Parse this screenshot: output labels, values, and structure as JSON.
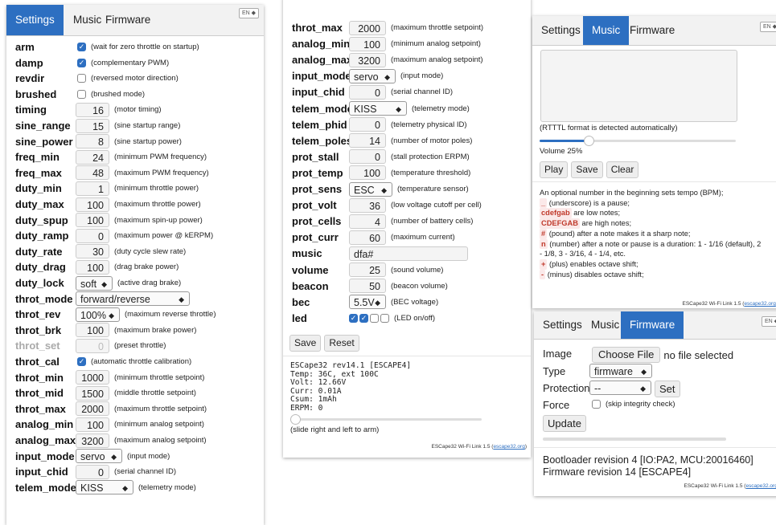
{
  "tabs": [
    "Settings",
    "Music",
    "Firmware"
  ],
  "lang": "EN",
  "left_params": [
    {
      "label": "arm",
      "type": "check",
      "checked": true,
      "desc": "(wait for zero throttle on startup)"
    },
    {
      "label": "damp",
      "type": "check",
      "checked": true,
      "desc": "(complementary PWM)"
    },
    {
      "label": "revdir",
      "type": "check",
      "checked": false,
      "desc": "(reversed motor direction)"
    },
    {
      "label": "brushed",
      "type": "check",
      "checked": false,
      "desc": "(brushed mode)"
    },
    {
      "label": "timing",
      "type": "num",
      "value": "16",
      "desc": "(motor timing)"
    },
    {
      "label": "sine_range",
      "type": "num",
      "value": "15",
      "desc": "(sine startup range)"
    },
    {
      "label": "sine_power",
      "type": "num",
      "value": "8",
      "desc": "(sine startup power)"
    },
    {
      "label": "freq_min",
      "type": "num",
      "value": "24",
      "desc": "(minimum PWM frequency)"
    },
    {
      "label": "freq_max",
      "type": "num",
      "value": "48",
      "desc": "(maximum PWM frequency)"
    },
    {
      "label": "duty_min",
      "type": "num",
      "value": "1",
      "desc": "(minimum throttle power)"
    },
    {
      "label": "duty_max",
      "type": "num",
      "value": "100",
      "desc": "(maximum throttle power)"
    },
    {
      "label": "duty_spup",
      "type": "num",
      "value": "100",
      "desc": "(maximum spin-up power)"
    },
    {
      "label": "duty_ramp",
      "type": "num",
      "value": "0",
      "desc": "(maximum power @ kERPM)"
    },
    {
      "label": "duty_rate",
      "type": "num",
      "value": "30",
      "desc": "(duty cycle slew rate)"
    },
    {
      "label": "duty_drag",
      "type": "num",
      "value": "100",
      "desc": "(drag brake power)"
    },
    {
      "label": "duty_lock",
      "type": "select",
      "value": "soft",
      "w": 46,
      "desc": "(active drag brake)"
    },
    {
      "label": "throt_mode",
      "type": "select",
      "value": "forward/reverse",
      "w": 142,
      "desc": ""
    },
    {
      "label": "throt_rev",
      "type": "select",
      "value": "100%",
      "w": 55,
      "desc": "(maximum reverse throttle)"
    },
    {
      "label": "throt_brk",
      "type": "num",
      "value": "100",
      "desc": "(maximum brake power)"
    },
    {
      "label": "throt_set",
      "type": "num",
      "value": "0",
      "desc": "(preset throttle)",
      "disabled": true
    },
    {
      "label": "throt_cal",
      "type": "check",
      "checked": true,
      "desc": "(automatic throttle calibration)"
    },
    {
      "label": "throt_min",
      "type": "num",
      "value": "1000",
      "desc": "(minimum throttle setpoint)"
    },
    {
      "label": "throt_mid",
      "type": "num",
      "value": "1500",
      "desc": "(middle throttle setpoint)"
    },
    {
      "label": "throt_max",
      "type": "num",
      "value": "2000",
      "desc": "(maximum throttle setpoint)"
    },
    {
      "label": "analog_min",
      "type": "num",
      "value": "100",
      "desc": "(minimum analog setpoint)"
    },
    {
      "label": "analog_max",
      "type": "num",
      "value": "3200",
      "desc": "(maximum analog setpoint)"
    },
    {
      "label": "input_mode",
      "type": "select",
      "value": "servo",
      "w": 58,
      "desc": "(input mode)"
    },
    {
      "label": "input_chid",
      "type": "num",
      "value": "0",
      "desc": "(serial channel ID)"
    },
    {
      "label": "telem_mode",
      "type": "select",
      "value": "KISS",
      "w": 72,
      "desc": "(telemetry mode)"
    }
  ],
  "mid_params": [
    {
      "label": "throt_max",
      "type": "num",
      "value": "2000",
      "desc": "(maximum throttle setpoint)"
    },
    {
      "label": "analog_min",
      "type": "num",
      "value": "100",
      "desc": "(minimum analog setpoint)"
    },
    {
      "label": "analog_max",
      "type": "num",
      "value": "3200",
      "desc": "(maximum analog setpoint)"
    },
    {
      "label": "input_mode",
      "type": "select",
      "value": "servo",
      "w": 58,
      "desc": "(input mode)"
    },
    {
      "label": "input_chid",
      "type": "num",
      "value": "0",
      "desc": "(serial channel ID)"
    },
    {
      "label": "telem_mode",
      "type": "select",
      "value": "KISS",
      "w": 72,
      "desc": "(telemetry mode)"
    },
    {
      "label": "telem_phid",
      "type": "num",
      "value": "0",
      "desc": "(telemetry physical ID)"
    },
    {
      "label": "telem_poles",
      "type": "num",
      "value": "14",
      "desc": "(number of motor poles)"
    },
    {
      "label": "prot_stall",
      "type": "num",
      "value": "0",
      "desc": "(stall protection ERPM)"
    },
    {
      "label": "prot_temp",
      "type": "num",
      "value": "100",
      "desc": "(temperature threshold)"
    },
    {
      "label": "prot_sens",
      "type": "select",
      "value": "ESC",
      "w": 54,
      "desc": "(temperature sensor)"
    },
    {
      "label": "prot_volt",
      "type": "num",
      "value": "36",
      "desc": "(low voltage cutoff per cell)"
    },
    {
      "label": "prot_cells",
      "type": "num",
      "value": "4",
      "desc": "(number of battery cells)"
    },
    {
      "label": "prot_curr",
      "type": "num",
      "value": "60",
      "desc": "(maximum current)"
    },
    {
      "label": "music",
      "type": "text",
      "value": "dfa#",
      "desc": ""
    },
    {
      "label": "volume",
      "type": "num",
      "value": "25",
      "desc": "(sound volume)"
    },
    {
      "label": "beacon",
      "type": "num",
      "value": "50",
      "desc": "(beacon volume)"
    },
    {
      "label": "bec",
      "type": "select",
      "value": "5.5V",
      "w": 46,
      "desc": "(BEC voltage)"
    },
    {
      "label": "led",
      "type": "leds",
      "leds": [
        true,
        true,
        false,
        false
      ],
      "desc": "(LED on/off)"
    }
  ],
  "mid_buttons": {
    "save": "Save",
    "reset": "Reset"
  },
  "status_lines": [
    "ESCape32 rev14.1 [ESCAPE4]",
    "Temp: 36C, ext 100C",
    "Volt: 12.66V",
    "Curr: 0.01A",
    "Csum: 1mAh",
    "ERPM: 0"
  ],
  "arm_hint": "(slide right and left to arm)",
  "footer_text": "ESCape32 Wi-Fi Link 1.5 (",
  "footer_link": "escape32.org",
  "footer_close": ")",
  "music": {
    "format_hint": "(RTTTL format is detected automatically)",
    "volume_label": "Volume 25%",
    "volume_pct": 25,
    "buttons": [
      "Play",
      "Save",
      "Clear"
    ],
    "help_intro": "An optional number in the beginning sets tempo (BPM);",
    "help": [
      {
        "code": "_",
        "text": " (underscore) is a pause;"
      },
      {
        "code": "cdefgab",
        "text": " are low notes;"
      },
      {
        "code": "CDEFGAB",
        "text": " are high notes;"
      },
      {
        "code": "#",
        "text": " (pound) after a note makes it a sharp note;"
      },
      {
        "code": "n",
        "text": " (number) after a note or pause is a duration: 1 - 1/16 (default), 2"
      }
    ],
    "help_cont": "- 1/8, 3 - 3/16, 4 - 1/4, etc.",
    "help_tail": [
      {
        "code": "+",
        "text": " (plus) enables octave shift;"
      },
      {
        "code": "-",
        "text": " (minus) disables octave shift;"
      }
    ]
  },
  "firmware": {
    "image_label": "Image",
    "choose_file": "Choose File",
    "no_file": "no file selected",
    "type_label": "Type",
    "type_value": "firmware",
    "protection_label": "Protection",
    "protection_value": "--",
    "set_button": "Set",
    "force_label": "Force",
    "force_desc": "(skip integrity check)",
    "update_button": "Update",
    "bootloader": "Bootloader revision 4 [IO:PA2, MCU:20016460]",
    "fw_revision": "Firmware revision 14 [ESCAPE4]"
  },
  "colors": {
    "accent": "#2d6fc1",
    "code_bg": "#fbe9e9",
    "code_fg": "#c0392b"
  }
}
